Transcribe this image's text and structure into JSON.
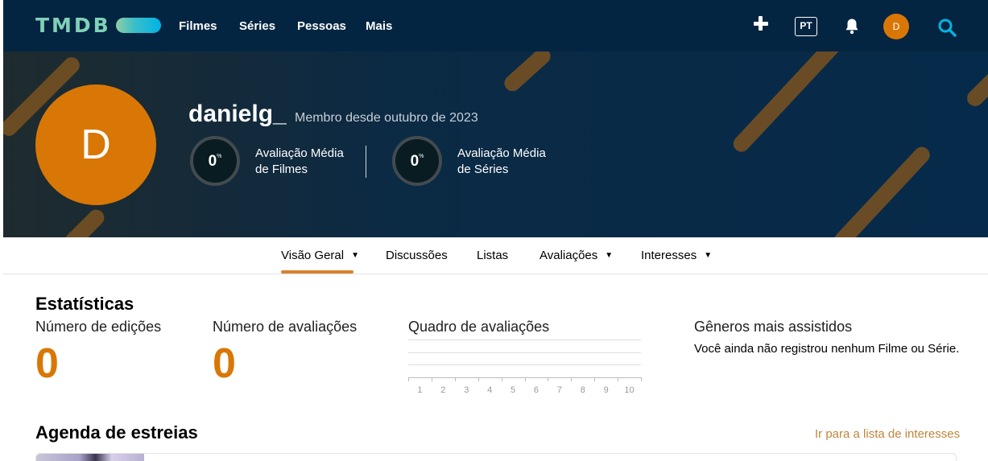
{
  "header": {
    "logo_text": "TMDB",
    "nav": {
      "movies": "Filmes",
      "tv": "Séries",
      "people": "Pessoas",
      "more": "Mais"
    },
    "language": "PT",
    "user_initial": "D",
    "icons": [
      "plus-icon",
      "bell-icon",
      "search-icon"
    ]
  },
  "profile": {
    "initial": "D",
    "username": "danielg_",
    "member_since": "Membro desde outubro de 2023",
    "movie_score": {
      "value": "0",
      "unit": "%",
      "label_line1": "Avaliação Média",
      "label_line2": "de Filmes"
    },
    "tv_score": {
      "value": "0",
      "unit": "%",
      "label_line1": "Avaliação Média",
      "label_line2": "de Séries"
    }
  },
  "tabs": {
    "overview": "Visão Geral",
    "discussions": "Discussões",
    "lists": "Listas",
    "ratings": "Avaliações",
    "watchlist": "Interesses",
    "caret": "▼"
  },
  "stats": {
    "title": "Estatísticas",
    "edits_label": "Número de edições",
    "edits_value": "0",
    "ratings_label": "Número de avaliações",
    "ratings_value": "0",
    "chart_label": "Quadro de avaliações",
    "genres_label": "Gêneros mais assistidos",
    "genres_empty": "Você ainda não registrou nenhum Filme ou Série."
  },
  "chart_data": {
    "type": "bar",
    "categories": [
      "1",
      "2",
      "3",
      "4",
      "5",
      "6",
      "7",
      "8",
      "9",
      "10"
    ],
    "values": [
      0,
      0,
      0,
      0,
      0,
      0,
      0,
      0,
      0,
      0
    ],
    "title": "Quadro de avaliações",
    "xlabel": "",
    "ylabel": "",
    "grid": true
  },
  "agenda": {
    "title": "Agenda de estreias",
    "link": "Ir para a lista de interesses"
  },
  "colors": {
    "nav_bg": "#032541",
    "accent_orange": "#d97706",
    "logo_green": "#7fd1b8",
    "logo_blue": "#01b4e4",
    "tab_underline": "#d9822b"
  }
}
